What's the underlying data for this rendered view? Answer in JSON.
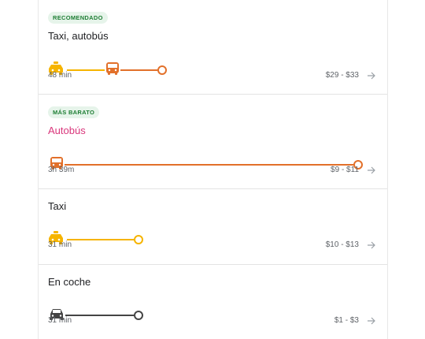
{
  "colors": {
    "taxi": "#f6b400",
    "bus": "#e2702a",
    "car": "#444444",
    "badge_bg": "#e6f4ea",
    "badge_text": "#1e7e34",
    "cheap_title": "#d9367b"
  },
  "options": [
    {
      "badge": "RECOMENDADO",
      "title": "Taxi, autobús",
      "modes": [
        "taxi-icon",
        "bus-icon"
      ],
      "duration": "48 min",
      "price": "$29 - $33"
    },
    {
      "badge": "MÁS BARATO",
      "title": "Autobús",
      "modes": [
        "bus-icon"
      ],
      "duration": "3h 39m",
      "price": "$9 - $11"
    },
    {
      "title": "Taxi",
      "modes": [
        "taxi-icon"
      ],
      "duration": "31 min",
      "price": "$10 - $13"
    },
    {
      "title": "En coche",
      "modes": [
        "car-icon"
      ],
      "duration": "31 min",
      "price": "$1 - $3"
    }
  ]
}
